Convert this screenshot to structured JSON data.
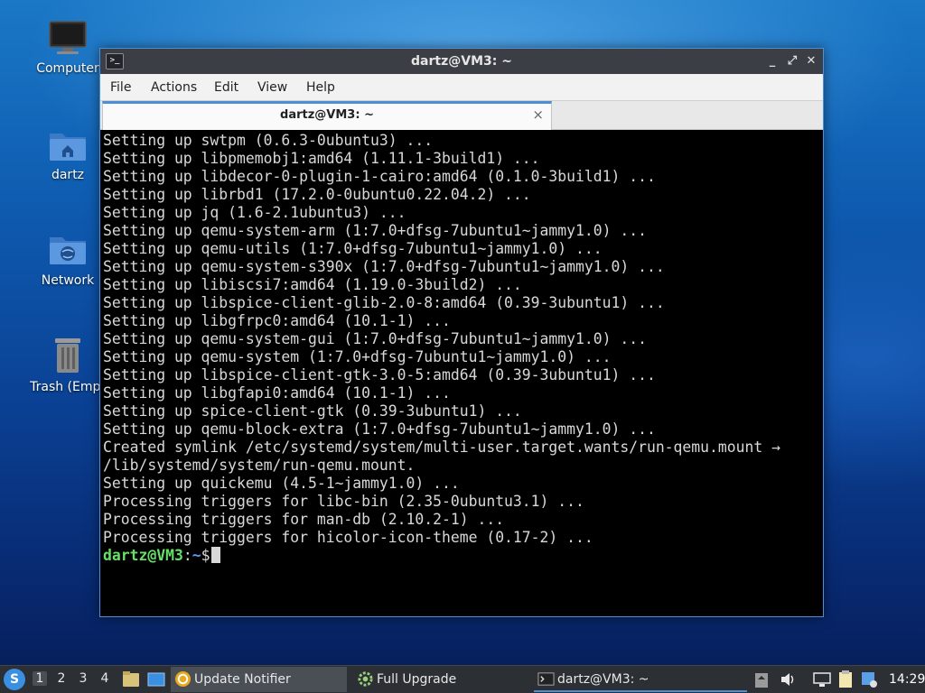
{
  "desktop": {
    "icons": [
      {
        "label": "Computer",
        "icon": "monitor-icon"
      },
      {
        "label": "dartz",
        "icon": "home-folder-icon"
      },
      {
        "label": "Network",
        "icon": "network-folder-icon"
      },
      {
        "label": "Trash (Empt",
        "icon": "trash-icon"
      }
    ]
  },
  "window": {
    "title": "dartz@VM3: ~",
    "menu": [
      "File",
      "Actions",
      "Edit",
      "View",
      "Help"
    ],
    "tab_label": "dartz@VM3: ~",
    "tab_close": "×",
    "buttons": {
      "minimize": "_",
      "maximize": "⤢",
      "close": "✕"
    }
  },
  "terminal": {
    "lines": [
      "Setting up swtpm (0.6.3-0ubuntu3) ...",
      "Setting up libpmemobj1:amd64 (1.11.1-3build1) ...",
      "Setting up libdecor-0-plugin-1-cairo:amd64 (0.1.0-3build1) ...",
      "Setting up librbd1 (17.2.0-0ubuntu0.22.04.2) ...",
      "Setting up jq (1.6-2.1ubuntu3) ...",
      "Setting up qemu-system-arm (1:7.0+dfsg-7ubuntu1~jammy1.0) ...",
      "Setting up qemu-utils (1:7.0+dfsg-7ubuntu1~jammy1.0) ...",
      "Setting up qemu-system-s390x (1:7.0+dfsg-7ubuntu1~jammy1.0) ...",
      "Setting up libiscsi7:amd64 (1.19.0-3build2) ...",
      "Setting up libspice-client-glib-2.0-8:amd64 (0.39-3ubuntu1) ...",
      "Setting up libgfrpc0:amd64 (10.1-1) ...",
      "Setting up qemu-system-gui (1:7.0+dfsg-7ubuntu1~jammy1.0) ...",
      "Setting up qemu-system (1:7.0+dfsg-7ubuntu1~jammy1.0) ...",
      "Setting up libspice-client-gtk-3.0-5:amd64 (0.39-3ubuntu1) ...",
      "Setting up libgfapi0:amd64 (10.1-1) ...",
      "Setting up spice-client-gtk (0.39-3ubuntu1) ...",
      "Setting up qemu-block-extra (1:7.0+dfsg-7ubuntu1~jammy1.0) ...",
      "Created symlink /etc/systemd/system/multi-user.target.wants/run-qemu.mount →",
      "/lib/systemd/system/run-qemu.mount.",
      "Setting up quickemu (4.5-1~jammy1.0) ...",
      "Processing triggers for libc-bin (2.35-0ubuntu3.1) ...",
      "Processing triggers for man-db (2.10.2-1) ...",
      "Processing triggers for hicolor-icon-theme (0.17-2) ..."
    ],
    "prompt_user": "dartz@VM3",
    "prompt_sep": ":",
    "prompt_path": "~",
    "prompt_symbol": "$"
  },
  "taskbar": {
    "workspaces": [
      "1",
      "2",
      "3",
      "4"
    ],
    "active_workspace": "1",
    "tasks": [
      {
        "label": "Update Notifier",
        "icon": "update-notifier-icon"
      },
      {
        "label": "Full Upgrade",
        "icon": "gear-icon"
      },
      {
        "label": "dartz@VM3: ~",
        "icon": "terminal-icon"
      }
    ],
    "clock": "14:29"
  },
  "colors": {
    "prompt_user": "#66e066",
    "prompt_path": "#5b9cf5",
    "window_accent": "#4d8fd6",
    "terminal_bg": "#000000"
  }
}
